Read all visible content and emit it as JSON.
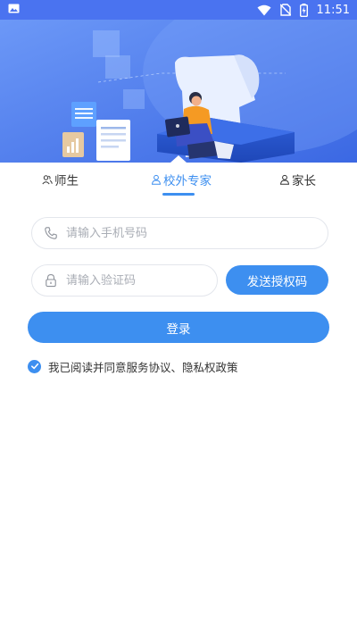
{
  "status_bar": {
    "time": "11:51",
    "icons": [
      "image-icon",
      "wifi-icon",
      "no-sim-icon",
      "battery-charging-icon"
    ]
  },
  "tabs": [
    {
      "label": "师生",
      "icon": "user-group-icon",
      "active": false
    },
    {
      "label": "校外专家",
      "icon": "user-icon",
      "active": true
    },
    {
      "label": "家长",
      "icon": "user-icon",
      "active": false
    }
  ],
  "form": {
    "phone": {
      "placeholder": "请输入手机号码",
      "value": "",
      "icon": "phone-icon"
    },
    "code": {
      "placeholder": "请输入验证码",
      "value": "",
      "icon": "lock-icon"
    },
    "send_code_label": "发送授权码",
    "login_label": "登录",
    "agreement_text": "我已阅读并同意服务协议、隐私权政策",
    "agreement_checked": true
  },
  "colors": {
    "accent": "#3d8ff0",
    "status_bar": "#4a73f0",
    "banner": "#4a7cf2"
  }
}
